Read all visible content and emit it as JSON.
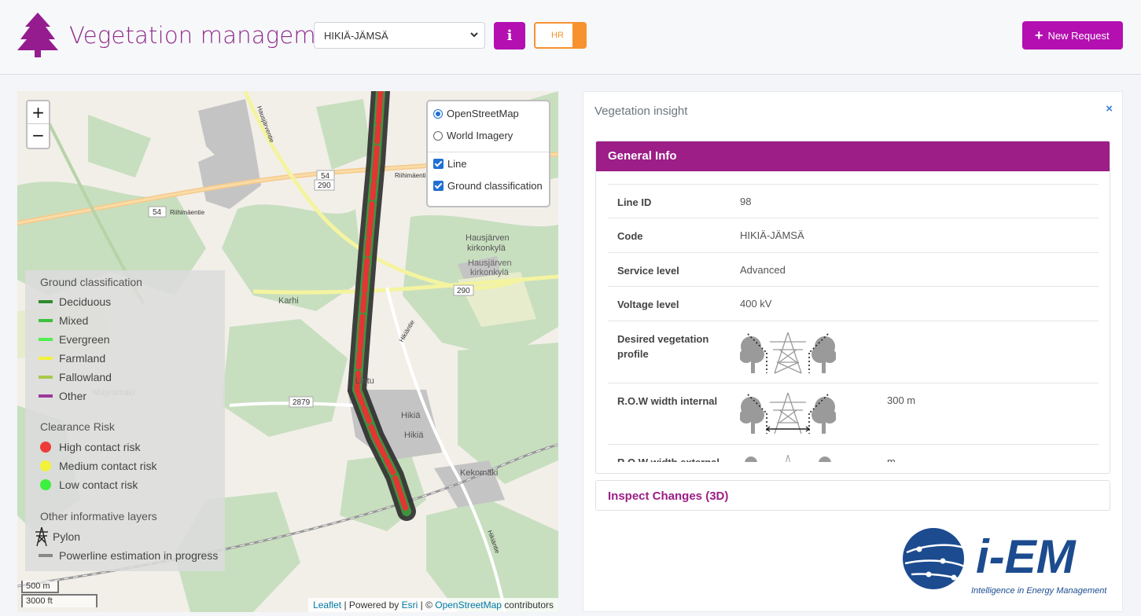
{
  "header": {
    "title": "Vegetation management:",
    "selected_line": "HIKIÄ-JÄMSÄ",
    "info_label": "i",
    "toggle_label": "HR",
    "new_request_label": "New Request",
    "brand_color": "#b40fb0",
    "toggle_color": "#f7922f"
  },
  "map": {
    "zoom_in": "+",
    "zoom_out": "−",
    "base_layers": [
      {
        "label": "OpenStreetMap",
        "selected": true
      },
      {
        "label": "World Imagery",
        "selected": false
      }
    ],
    "overlays": [
      {
        "label": "Line",
        "checked": true
      },
      {
        "label": "Ground classification",
        "checked": true
      }
    ],
    "place_labels": [
      "Hausjärven kirkonkylä",
      "Hausjärven kirkonkylä",
      "Karhi",
      "Hikiä",
      "Hikiä",
      "Lintu",
      "Kekomäki",
      "Mäyrämäki",
      "Riihimäentie",
      "Riihimäentie",
      "Hikiäntie",
      "Hikiäntie",
      "Hausjärventie"
    ],
    "road_numbers": [
      "54",
      "290",
      "54",
      "290",
      "2879"
    ],
    "legend": {
      "ground_title": "Ground classification",
      "ground_items": [
        {
          "label": "Deciduous",
          "color": "#2e8b2e"
        },
        {
          "label": "Mixed",
          "color": "#3cc13c"
        },
        {
          "label": "Evergreen",
          "color": "#4ef04e"
        },
        {
          "label": "Farmland",
          "color": "#f2f23a"
        },
        {
          "label": "Fallowland",
          "color": "#a8c84a"
        },
        {
          "label": "Other",
          "color": "#9b3a9b"
        }
      ],
      "risk_title": "Clearance Risk",
      "risk_items": [
        {
          "label": "High contact risk",
          "color": "#ee3b3b"
        },
        {
          "label": "Medium contact risk",
          "color": "#f2f23a"
        },
        {
          "label": "Low contact risk",
          "color": "#3ef03e"
        }
      ],
      "other_title": "Other informative layers",
      "other_items": [
        {
          "label": "Pylon",
          "icon": "pylon-icon"
        },
        {
          "label": "Powerline estimation in progress",
          "color": "#888888"
        }
      ]
    },
    "scale_metric": "500 m",
    "scale_imperial": "3000 ft",
    "attribution": {
      "leaflet": "Leaflet",
      "sep1": " | Powered by ",
      "esri": "Esri",
      "sep2": " | © ",
      "osm": "OpenStreetMap",
      "tail": " contributors"
    }
  },
  "panel": {
    "title": "Vegetation insight",
    "close": "×",
    "card_title": "General Info",
    "rows": [
      {
        "key": "Line ID",
        "value": "98"
      },
      {
        "key": "Code",
        "value": "HIKIÄ-JÄMSÄ"
      },
      {
        "key": "Service level",
        "value": "Advanced"
      },
      {
        "key": "Voltage level",
        "value": "400 kV"
      },
      {
        "key": "Desired vegetation profile",
        "value": ""
      },
      {
        "key": "R.O.W width internal",
        "value": "300 m"
      },
      {
        "key": "R.O.W width external",
        "value": "m"
      }
    ],
    "inspect_label": "Inspect Changes (3D)",
    "logo_text": "i-EM",
    "logo_tagline": "Intelligence in Energy Management"
  }
}
